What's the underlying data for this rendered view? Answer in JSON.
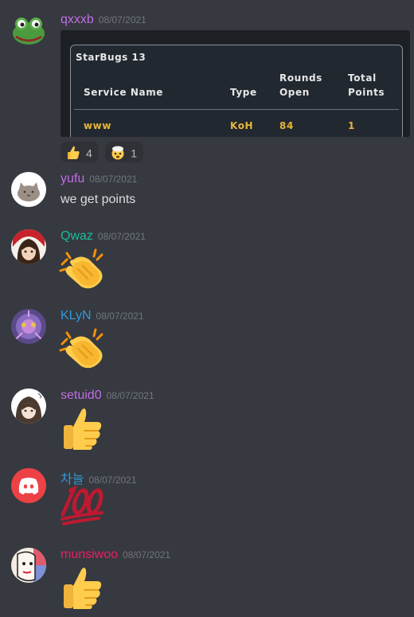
{
  "messages": [
    {
      "username": "qxxxb",
      "timestamp": "08/07/2021",
      "name_color": "#c26ce6",
      "avatar": "frog-avatar",
      "attachment": {
        "title": "StarBugs 13",
        "headers": [
          "Service Name",
          "Type",
          "Rounds Open",
          "Total Points"
        ],
        "headers_split": {
          "rounds_1": "Rounds",
          "rounds_2": "Open",
          "total_1": "Total",
          "total_2": "Points"
        },
        "row": [
          "www",
          "KoH",
          "84",
          "1"
        ]
      },
      "reactions": [
        {
          "emoji": "thumbs-up-icon",
          "count": "4"
        },
        {
          "emoji": "exploding-head-icon",
          "count": "1"
        }
      ]
    },
    {
      "username": "yufu",
      "timestamp": "08/07/2021",
      "name_color": "#c26ce6",
      "avatar": "cat-avatar",
      "text": "we get points"
    },
    {
      "username": "Qwaz",
      "timestamp": "08/07/2021",
      "name_color": "#1abc9c",
      "avatar": "anime-girl-avatar",
      "emoji": "clapping-hands-icon"
    },
    {
      "username": "KLyN",
      "timestamp": "08/07/2021",
      "name_color": "#3498db",
      "avatar": "purple-art-avatar",
      "emoji": "clapping-hands-icon"
    },
    {
      "username": "setuid0",
      "timestamp": "08/07/2021",
      "name_color": "#c26ce6",
      "avatar": "sketch-girl-avatar",
      "emoji": "thumbs-up-icon"
    },
    {
      "username": "차늘",
      "timestamp": "08/07/2021",
      "name_color": "#3498db",
      "avatar": "discord-default-avatar",
      "emoji": "hundred-points-icon"
    },
    {
      "username": "munsiwoo",
      "timestamp": "08/07/2021",
      "name_color": "#e91e63",
      "avatar": "face-art-avatar",
      "emoji": "thumbs-up-icon"
    }
  ]
}
